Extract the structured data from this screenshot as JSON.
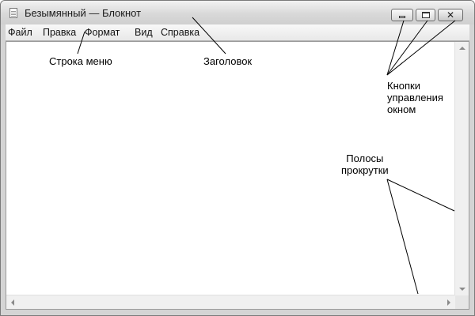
{
  "window": {
    "title": "Безымянный — Блокнот",
    "close_glyph": "✕"
  },
  "menu": {
    "items": [
      "Файл",
      "Правка",
      "Формат",
      "Вид",
      "Справка"
    ]
  },
  "annotations": {
    "menu_bar": "Строка меню",
    "title": "Заголовок",
    "window_buttons": [
      "Кнопки",
      "управления",
      "окном"
    ],
    "scrollbars": [
      "Полосы",
      "прокрутки"
    ]
  },
  "icons": {
    "app": "notepad-icon",
    "minimize": "minimize-icon",
    "maximize": "maximize-icon",
    "close": "close-icon"
  }
}
